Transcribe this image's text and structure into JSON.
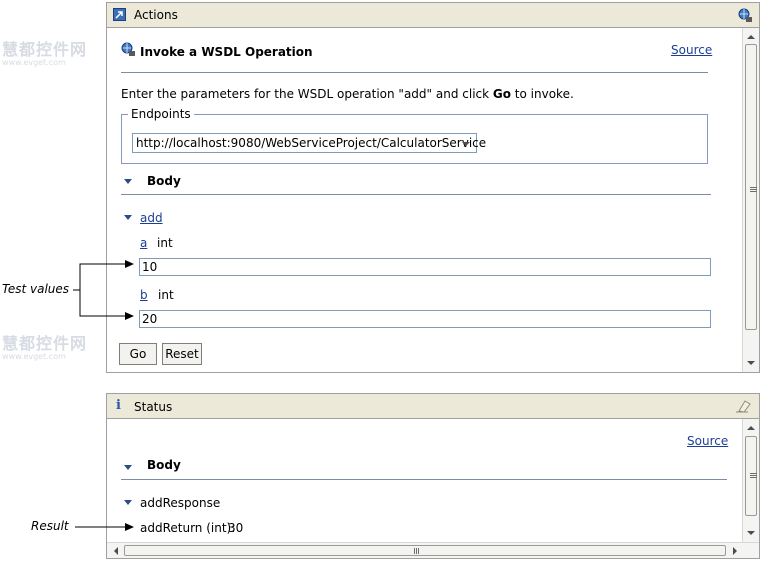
{
  "actions_panel": {
    "title": "Actions",
    "heading": "Invoke a WSDL Operation",
    "source_link": "Source",
    "instruction_pre": "Enter the parameters for the WSDL operation \"add\" and click ",
    "instruction_bold": "Go",
    "instruction_post": " to invoke.",
    "endpoints_legend": "Endpoints",
    "endpoint_selected": "http://localhost:9080/WebServiceProject/CalculatorService",
    "body_label": "Body",
    "operation_link": "add",
    "param_a_name": "a",
    "param_a_type": "int",
    "param_a_value": "10",
    "param_b_name": "b",
    "param_b_type": "int",
    "param_b_value": "20",
    "go_label": "Go",
    "reset_label": "Reset"
  },
  "status_panel": {
    "title": "Status",
    "source_link": "Source",
    "body_label": "Body",
    "response_label": "addResponse",
    "result_label": "addReturn (int):",
    "result_value": "30"
  },
  "annotations": {
    "test_values": "Test values",
    "result": "Result"
  },
  "colors": {
    "panel_header": "#ece9d8",
    "link": "#1c3f95",
    "separator": "#7e8aa8"
  }
}
